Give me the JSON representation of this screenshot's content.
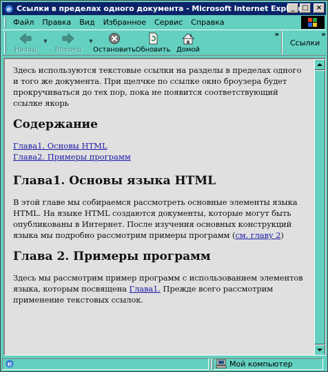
{
  "window": {
    "title": "Ссылки в пределах одного документа - Microsoft Internet Explorer",
    "minimize_glyph": "_",
    "maximize_glyph": "□",
    "close_glyph": "×"
  },
  "menu": {
    "items": [
      {
        "label": "Файл"
      },
      {
        "label": "Правка"
      },
      {
        "label": "Вид"
      },
      {
        "label": "Избранное"
      },
      {
        "label": "Сервис"
      },
      {
        "label": "Справка"
      }
    ]
  },
  "toolbar": {
    "back_label": "Назад",
    "forward_label": "Вперед",
    "stop_label": "Остановить",
    "refresh_label": "Обновить",
    "home_label": "Домой",
    "links_label": "Ссылки",
    "chevron": "»"
  },
  "document": {
    "intro": "Здесь используются текстовые ссылки на разделы в пределах одного и того же документа. При щелчке по ссылке окно броузера будет прокручиваться до тех пор, пока не появится соответствующий ссылке якорь",
    "toc_heading": "Содержание",
    "toc_links": [
      {
        "label": "Глава1. Основы HTML"
      },
      {
        "label": "Глава2. Примеры программ"
      }
    ],
    "chapter1_heading": "Глава1. Основы языка HTML",
    "chapter1_text": "В этой главе мы собираемся рассмотреть основные элементы языка HTML. На языке HTML создаются документы, которые могут быть опубликованы в Интернет. После изучения основных конструкций языка мы подробно рассмотрим примеры программ (",
    "chapter1_link": "см. главу 2",
    "chapter1_tail": ")",
    "chapter2_heading": "Глава 2. Примеры программ",
    "chapter2_text": "Здесь мы рассмотрим пример программ с использованием элементов языка, которым посвящена ",
    "chapter2_link": "Глава1.",
    "chapter2_tail": " Прежде всего рассмотрим применение текстовых ссылок."
  },
  "status": {
    "zone_text": "Мой компьютер"
  },
  "colors": {
    "chrome": "#64d0c0",
    "title_bar": "#0a246a",
    "document_bg": "#e0e0e0",
    "link": "#1a1aa6"
  }
}
